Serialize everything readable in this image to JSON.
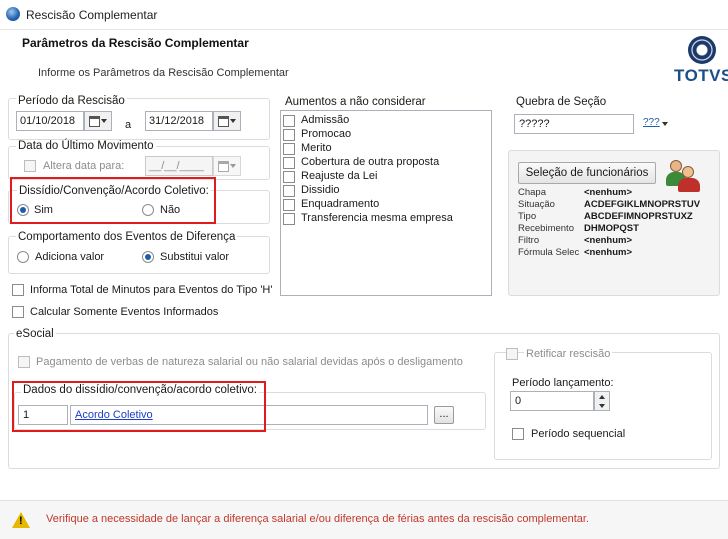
{
  "window": {
    "title": "Rescisão Complementar"
  },
  "header": {
    "title": "Parâmetros da Rescisão Complementar",
    "subtitle": "Informe os Parâmetros da Rescisão Complementar",
    "logo_text": "TOTVS"
  },
  "periodo": {
    "label": "Período da Rescisão",
    "start": "01/10/2018",
    "sep": "a",
    "end": "31/12/2018"
  },
  "ultimo_movimento": {
    "label": "Data do Último Movimento",
    "alter_label": "Altera data para:",
    "date_placeholder": "__/__/____"
  },
  "dissidio": {
    "label": "Dissídio/Convenção/Acordo Coletivo:",
    "options": [
      "Sim",
      "Não"
    ],
    "selected": "Sim"
  },
  "comportamento": {
    "label": "Comportamento dos Eventos de Diferença",
    "options": [
      "Adiciona valor",
      "Substitui valor"
    ],
    "selected": "Substitui valor"
  },
  "checks": {
    "informa_total": "Informa Total de Minutos para Eventos do Tipo 'H'",
    "calcular_somente": "Calcular Somente Eventos Informados"
  },
  "aumentos": {
    "label": "Aumentos a não considerar",
    "items": [
      "Admissão",
      "Promocao",
      "Merito",
      "Cobertura de outra proposta",
      "Reajuste da Lei",
      "Dissidio",
      "Enquadramento",
      "Transferencia mesma empresa"
    ]
  },
  "quebra": {
    "label": "Quebra de Seção",
    "value": "?????",
    "btn_glyph": "???"
  },
  "selecao": {
    "button": "Seleção de funcionários",
    "rows": [
      {
        "k": "Chapa",
        "v": "<nenhum>"
      },
      {
        "k": "Situação",
        "v": "ACDEFGIKLMNOPRSTUV"
      },
      {
        "k": "Tipo",
        "v": "ABCDEFIMNOPRSTUXZ"
      },
      {
        "k": "Recebimento",
        "v": "DHMOPQST"
      },
      {
        "k": "Filtro",
        "v": "<nenhum>"
      },
      {
        "k": "Fórmula Selec",
        "v": "<nenhum>"
      }
    ]
  },
  "esocial": {
    "label": "eSocial",
    "pagamento": "Pagamento de verbas de natureza salarial ou não salarial devidas após o desligamento",
    "dados_label": "Dados do dissídio/convenção/acordo coletivo:",
    "code": "1",
    "link": "Acordo Coletivo",
    "browse_btn": "...",
    "retificar": "Retificar rescisão",
    "periodo_lanc_label": "Período lançamento:",
    "periodo_lanc_value": "0",
    "periodo_seq": "Período sequencial"
  },
  "footer": {
    "warning": "Verifique a necessidade de lançar a diferença salarial e/ou diferença de férias antes da rescisão complementar."
  },
  "colors": {
    "accent": "#1b5eab",
    "highlight": "#e01b1b",
    "warning": "#c0392b"
  }
}
